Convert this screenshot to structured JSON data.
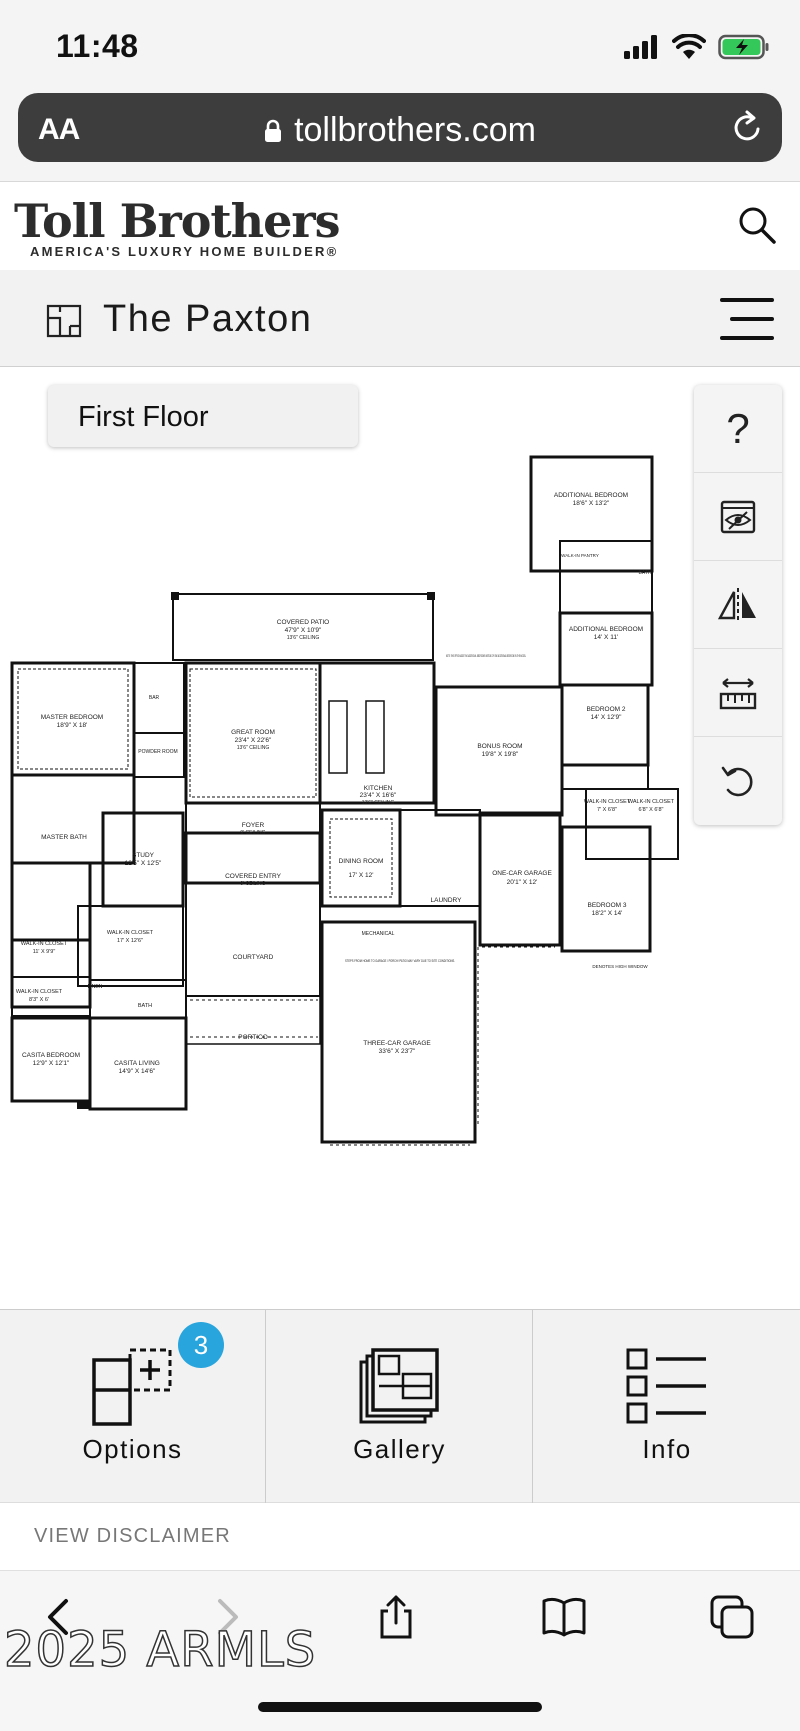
{
  "status_bar": {
    "time": "11:48"
  },
  "address_bar": {
    "text_size_label": "AA",
    "url": "tollbrothers.com"
  },
  "brand": {
    "logo_text": "Toll Brothers",
    "tagline": "AMERICA'S LUXURY HOME BUILDER®"
  },
  "plan": {
    "title": "The Paxton",
    "floor_selector": "First Floor"
  },
  "tools": {
    "help_label": "?"
  },
  "floorplan_labels": {
    "covered_patio": "COVERED PATIO",
    "covered_patio_dim": "47'9\" X 10'9\"",
    "covered_patio_ceiling": "13'6\" CEILING",
    "additional_bedroom_top": "ADDITIONAL BEDROOM",
    "additional_bedroom_top_dim": "18'6\" X 13'2\"",
    "walkin_pantry": "WALK-IN PANTRY",
    "bath": "BATH",
    "additional_bedroom_2": "ADDITIONAL BEDROOM",
    "additional_bedroom_2_dim": "14' X 11'",
    "note": "NOTE: THIS OPTION ADDS TWO ADDITIONAL BEDROOMS INSTEAD OF ONE ADDITIONAL BEDROOM ON THIS MODEL.",
    "bedroom2": "BEDROOM 2",
    "bedroom2_dim": "14' X 12'9\"",
    "master_bedroom": "MASTER BEDROOM",
    "master_bedroom_dim": "18'9\" X 18'",
    "great_room": "GREAT ROOM",
    "great_room_dim": "23'4\" X 22'6\"",
    "great_room_ceiling": "13'6\" CEILING",
    "kitchen": "KITCHEN",
    "kitchen_dim": "23'4\" X 16'6\"",
    "kitchen_ceiling": "13'6\" CEILING",
    "bonus_room": "BONUS ROOM",
    "bonus_room_dim": "19'8\" X 19'8\"",
    "powder_room": "POWDER ROOM",
    "bar": "BAR",
    "master_bath": "MASTER BATH",
    "foyer": "FOYER",
    "foyer_ceiling": "9' CEILING",
    "study": "STUDY",
    "study_dim": "12'5\" X 12'5\"",
    "covered_entry": "COVERED ENTRY",
    "covered_entry_ceiling": "9' CEILING",
    "dining_room": "DINING ROOM",
    "dining_room_dim": "17' X 12'",
    "laundry": "LAUNDRY",
    "one_car_garage": "ONE-CAR GARAGE",
    "one_car_garage_dim": "20'1\" X 12'",
    "walkin_closet_a": "WALK-IN CLOSET",
    "walkin_closet_a_dim": "7' X 6'8\"",
    "walkin_closet_b": "WALK-IN CLOSET",
    "walkin_closet_b_dim": "6'8\" X 6'8\"",
    "bedroom3": "BEDROOM 3",
    "bedroom3_dim": "18'2\" X 14'",
    "walkin_closet_master1": "WALK-IN CLOSET",
    "walkin_closet_master1_dim": "11' X 9'9\"",
    "walkin_closet_master2": "WALK-IN CLOSET",
    "walkin_closet_master2_dim": "17' X 12'6\"",
    "courtyard": "COURTYARD",
    "mechanical": "MECHANICAL",
    "garage_note": "STEPS FROM HOME TO GARAGE / PORCH/ PATIO MAY VARY DUE TO SITE CONDITIONS.",
    "high_window": "DENOTES HIGH WINDOW",
    "walkin_closet_casita": "WALK-IN CLOSET",
    "walkin_closet_casita_dim": "8'3\" X 6'",
    "linen": "LINEN",
    "casita_bath": "BATH",
    "portico": "PORTICO",
    "three_car_garage": "THREE-CAR GARAGE",
    "three_car_garage_dim": "33'6\" X 23'7\"",
    "casita_bedroom": "CASITA BEDROOM",
    "casita_bedroom_dim": "12'9\" X 12'1\"",
    "casita_living": "CASITA LIVING",
    "casita_living_dim": "14'9\" X 14'6\""
  },
  "tabs": [
    {
      "label": "Options",
      "badge": "3"
    },
    {
      "label": "Gallery"
    },
    {
      "label": "Info"
    }
  ],
  "disclaimer": {
    "label": "VIEW DISCLAIMER"
  },
  "watermark": {
    "text": "2025 ARMLS"
  },
  "colors": {
    "badge": "#29a5de",
    "battery": "#34c759"
  }
}
